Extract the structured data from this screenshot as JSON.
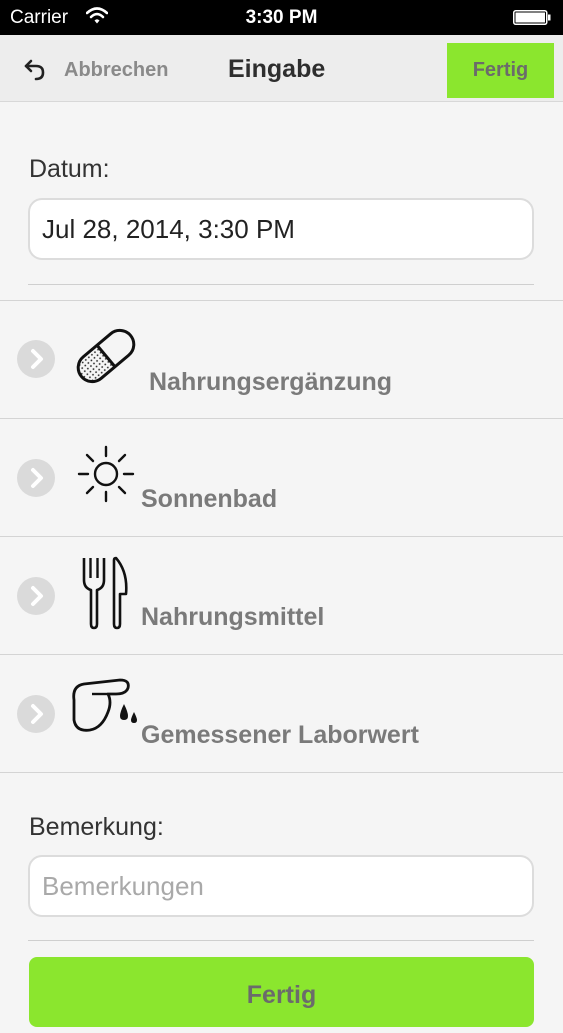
{
  "status_bar": {
    "carrier": "Carrier",
    "time": "3:30 PM"
  },
  "nav": {
    "cancel_label": "Abbrechen",
    "title": "Eingabe",
    "done_label": "Fertig"
  },
  "date_section": {
    "label": "Datum:",
    "value": "Jul 28, 2014, 3:30 PM"
  },
  "categories": [
    {
      "label": "Nahrungsergänzung",
      "icon": "pill-icon"
    },
    {
      "label": "Sonnenbad",
      "icon": "sun-icon"
    },
    {
      "label": "Nahrungsmittel",
      "icon": "fork-knife-icon"
    },
    {
      "label": "Gemessener Laborwert",
      "icon": "finger-blood-drop-icon"
    }
  ],
  "remarks": {
    "label": "Bemerkung:",
    "placeholder": "Bemerkungen"
  },
  "footer": {
    "done_label": "Fertig"
  },
  "colors": {
    "accent_green": "#8be62e",
    "nav_background": "#ededed"
  }
}
